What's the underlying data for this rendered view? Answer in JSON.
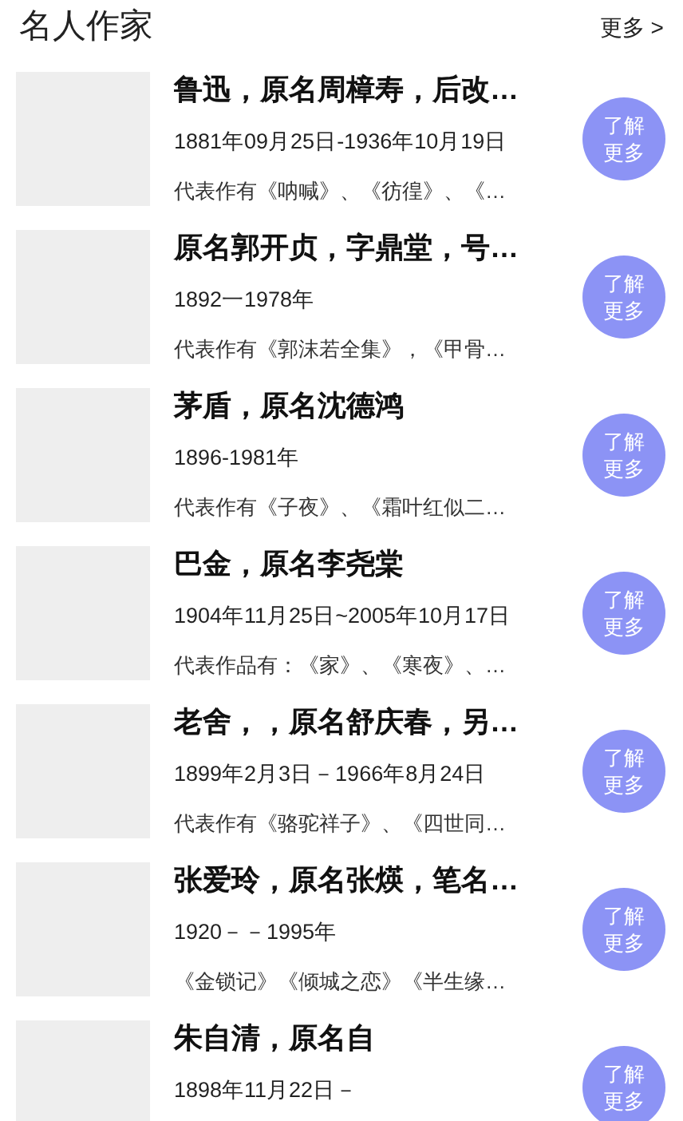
{
  "header": {
    "title": "名人作家",
    "more_link": "更多 >"
  },
  "authors": [
    {
      "name": "鲁迅，原名周樟寿，后改…",
      "dates": "1881年09月25日-1936年10月19日",
      "works": "代表作有《呐喊》、《彷徨》、《…",
      "button": "了解更多"
    },
    {
      "name": "原名郭开贞，字鼎堂，号…",
      "dates": "1892一1978年",
      "works": "代表作有《郭沫若全集》，《甲骨…",
      "button": "了解更多"
    },
    {
      "name": "茅盾，原名沈德鸿",
      "dates": "1896-1981年",
      "works": "代表作有《子夜》、《霜叶红似二…",
      "button": "了解更多"
    },
    {
      "name": "巴金，原名李尧棠",
      "dates": "1904年11月25日~2005年10月17日",
      "works": "代表作品有：《家》、《寒夜》、…",
      "button": "了解更多"
    },
    {
      "name": "老舍，，原名舒庆春，另…",
      "dates": "1899年2月3日－1966年8月24日",
      "works": "代表作有《骆驼祥子》、《四世同…",
      "button": "了解更多"
    },
    {
      "name": "张爱玲，原名张煐，笔名…",
      "dates": "1920－－1995年",
      "works": "《金锁记》《倾城之恋》《半生缘…",
      "button": "了解更多"
    },
    {
      "name": "朱自清，原名自",
      "dates": "1898年11月22日－",
      "button": "了解更多"
    }
  ]
}
